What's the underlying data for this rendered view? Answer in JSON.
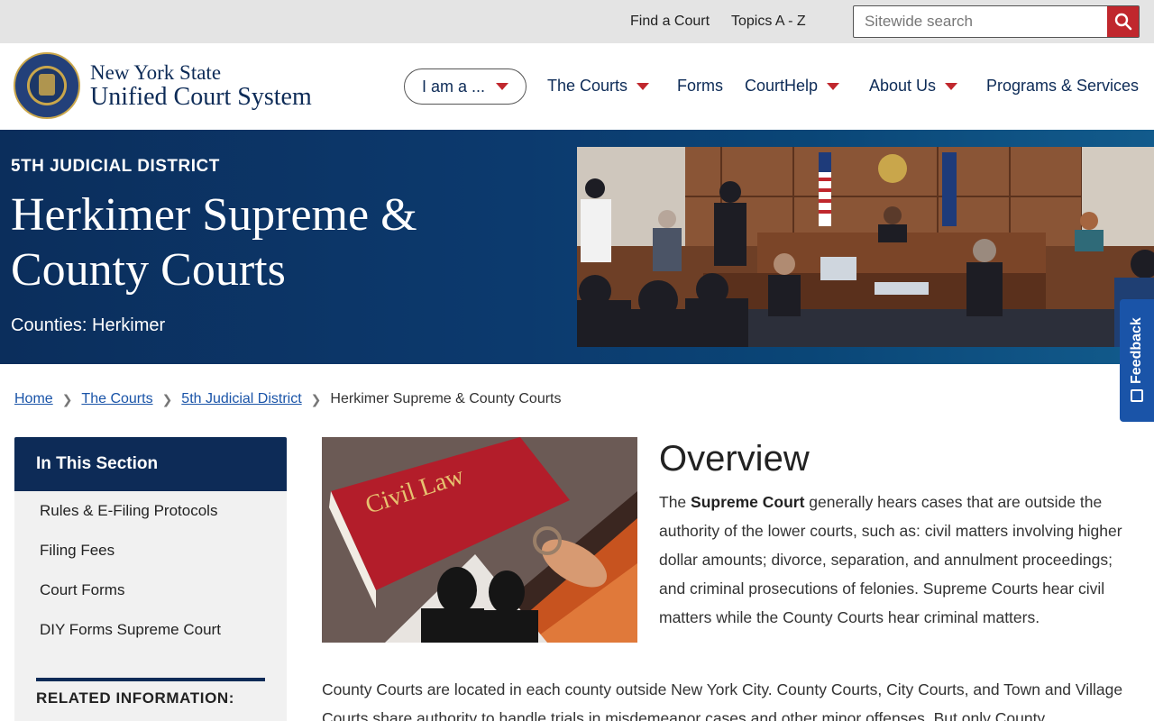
{
  "utility_bar": {
    "find_court": "Find a Court",
    "topics": "Topics A - Z",
    "search_placeholder": "Sitewide search"
  },
  "header": {
    "brand_line1": "New York State",
    "brand_line2": "Unified Court System",
    "nav": {
      "iama": "I am a ...",
      "courts": "The Courts",
      "forms": "Forms",
      "courthelp": "CourtHelp",
      "about": "About Us",
      "programs": "Programs & Services"
    }
  },
  "hero": {
    "kicker": "5TH JUDICIAL DISTRICT",
    "title": "Herkimer Supreme & County Courts",
    "counties": "Counties: Herkimer"
  },
  "feedback": {
    "label": "Feedback"
  },
  "breadcrumb": {
    "home": "Home",
    "courts": "The Courts",
    "district": "5th Judicial District",
    "current": "Herkimer Supreme & County Courts"
  },
  "sidebar": {
    "heading": "In This Section",
    "links": [
      "Rules & E-Filing Protocols",
      "Filing Fees",
      "Court Forms",
      "DIY Forms Supreme Court"
    ],
    "related_heading": "RELATED INFORMATION:"
  },
  "content": {
    "image_text": "Civil Law",
    "overview_title": "Overview",
    "overview_intro": "The ",
    "overview_bold": "Supreme Court",
    "overview_rest": " generally hears cases that are outside the authority of the lower courts, such as: civil matters involving higher dollar amounts; divorce, separation, and annulment proceedings; and criminal prosecutions of felonies. Supreme Courts hear civil matters while the County Courts hear criminal matters.",
    "county_para": "County Courts are located in each county outside New York City. County Courts, City Courts, and Town and Village Courts share authority to handle trials in misdemeanor cases and other minor offenses. But only County"
  },
  "colors": {
    "navy": "#0d2b57",
    "accent_red": "#c0272d",
    "link_blue": "#1a54a8",
    "feedback_blue": "#1a54a8"
  },
  "icons": [
    "search-icon",
    "caret-down-icon",
    "chevron-right-icon",
    "feedback-icon",
    "court-seal-logo"
  ]
}
